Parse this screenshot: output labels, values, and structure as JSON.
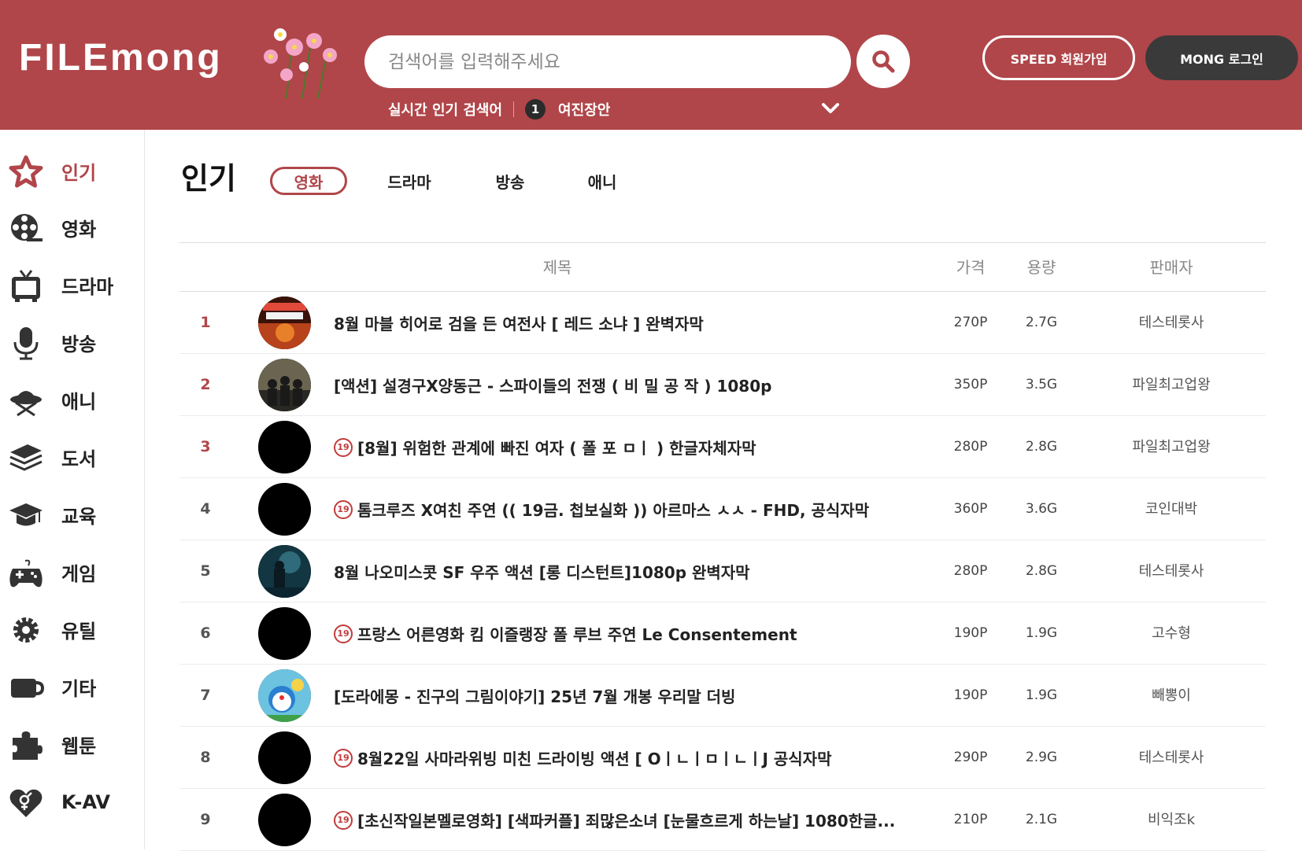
{
  "header": {
    "logo_text": "FILEmong",
    "search_placeholder": "검색어를 입력해주세요",
    "popular_label": "실시간 인기 검색어",
    "popular_rank": "1",
    "popular_keyword": "여진장안",
    "join_button": "SPEED 회원가입",
    "login_button": "MONG 로그인",
    "brand_color": "#b0464a"
  },
  "sidebar": {
    "items": [
      {
        "label": "인기",
        "icon": "star-icon"
      },
      {
        "label": "영화",
        "icon": "film-reel-icon"
      },
      {
        "label": "드라마",
        "icon": "tv-icon"
      },
      {
        "label": "방송",
        "icon": "microphone-icon"
      },
      {
        "label": "애니",
        "icon": "ufo-icon"
      },
      {
        "label": "도서",
        "icon": "books-icon"
      },
      {
        "label": "교육",
        "icon": "graduation-cap-icon"
      },
      {
        "label": "게임",
        "icon": "gamepad-icon"
      },
      {
        "label": "유틸",
        "icon": "gear-icon"
      },
      {
        "label": "기타",
        "icon": "cup-icon"
      },
      {
        "label": "웹툰",
        "icon": "puzzle-icon"
      },
      {
        "label": "K-AV",
        "icon": "heart-gender-icon"
      }
    ]
  },
  "main": {
    "title": "인기",
    "tabs": [
      "영화",
      "드라마",
      "방송",
      "애니"
    ],
    "columns": {
      "title": "제목",
      "price": "가격",
      "size": "용량",
      "seller": "판매자"
    },
    "rows": [
      {
        "rank": "1",
        "adult": false,
        "title": "8월 마블 히어로 검을 든 여전사 [ 레드 소냐 ] 완벽자막",
        "price": "270P",
        "size": "2.7G",
        "seller": "테스테롯사",
        "thumb": "poster-red"
      },
      {
        "rank": "2",
        "adult": false,
        "title": "[액션] 설경구X양동근 - 스파이들의 전쟁 ( 비 밀 공 작 ) 1080p",
        "price": "350P",
        "size": "3.5G",
        "seller": "파일최고업왕",
        "thumb": "poster-group"
      },
      {
        "rank": "3",
        "adult": true,
        "title": "[8월] 위험한 관계에 빠진 여자 ( 폴 포 ㅁㅣ ) 한글자체자막",
        "price": "280P",
        "size": "2.8G",
        "seller": "파일최고업왕",
        "thumb": "hidden"
      },
      {
        "rank": "4",
        "adult": true,
        "title": "톰크루즈 X여친 주연 (( 19금. 첩보실화 )) 아르마스 ㅅㅅ - FHD, 공식자막",
        "price": "360P",
        "size": "3.6G",
        "seller": "코인대박",
        "thumb": "hidden"
      },
      {
        "rank": "5",
        "adult": false,
        "title": "8월 나오미스콧 SF 우주 액션 [롱 디스턴트]1080p 완벽자막",
        "price": "280P",
        "size": "2.8G",
        "seller": "테스테롯사",
        "thumb": "poster-space"
      },
      {
        "rank": "6",
        "adult": true,
        "title": "프랑스 어른영화 킴 이즐랭장 폴 루브 주연 Le Consentement",
        "price": "190P",
        "size": "1.9G",
        "seller": "고수형",
        "thumb": "hidden"
      },
      {
        "rank": "7",
        "adult": false,
        "title": "[도라에몽 - 진구의 그림이야기] 25년 7월 개봉 우리말 더빙",
        "price": "190P",
        "size": "1.9G",
        "seller": "빼뽕이",
        "thumb": "poster-cartoon"
      },
      {
        "rank": "8",
        "adult": true,
        "title": "8월22일 사마라위빙 미친 드라이빙 액션 [ OㅣㄴㅣㅁㅣㄴㅣJ 공식자막",
        "price": "290P",
        "size": "2.9G",
        "seller": "테스테롯사",
        "thumb": "hidden"
      },
      {
        "rank": "9",
        "adult": true,
        "title": "[초신작일본멜로영화] [색파커플] 죄많은소녀 [눈물흐르게 하는날] 1080한글...",
        "price": "210P",
        "size": "2.1G",
        "seller": "비익조k",
        "thumb": "hidden"
      }
    ],
    "adult_badge": "19"
  }
}
